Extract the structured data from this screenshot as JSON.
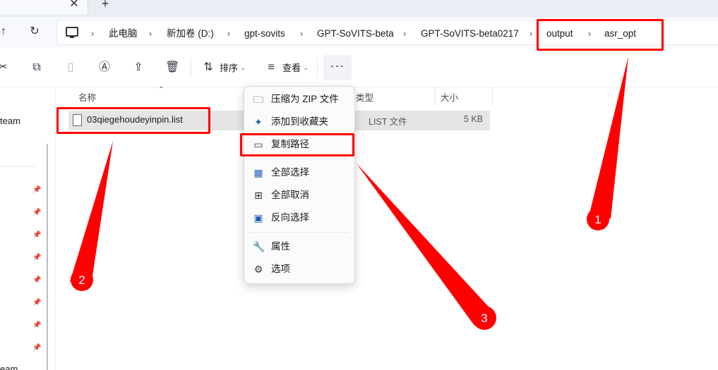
{
  "tab": {
    "close_glyph": "✕",
    "new_glyph": "+"
  },
  "nav": {
    "up_glyph": "↑",
    "refresh_glyph": "↻"
  },
  "breadcrumb": [
    "此电脑",
    "新加卷 (D:)",
    "gpt-sovits",
    "GPT-SoVITS-beta",
    "GPT-SoVITS-beta0217",
    "output",
    "asr_opt"
  ],
  "breadcrumb_separator": "›",
  "toolbar": {
    "sort_label": "排序",
    "view_label": "查看",
    "more_glyph": "···",
    "icons": [
      "cut-icon",
      "copy-icon",
      "paste-icon",
      "rename-icon",
      "share-icon",
      "delete-icon",
      "sort-icon",
      "view-icon"
    ]
  },
  "leftnav": {
    "item_top": "team",
    "item_bottom": "eam",
    "pin_glyph": "📌"
  },
  "columns": {
    "name": "名称",
    "type": "类型",
    "size": "大小"
  },
  "file": {
    "name": "03qiegehoudeyinpin.list",
    "type": "LIST 文件",
    "size": "5 KB"
  },
  "context_menu": [
    {
      "label": "压缩为 ZIP 文件",
      "icon": "zip-icon"
    },
    {
      "label": "添加到收藏夹",
      "icon": "pin-icon"
    },
    {
      "label": "复制路径",
      "icon": "copy-path-icon"
    },
    {
      "label": "全部选择",
      "icon": "select-all-icon"
    },
    {
      "label": "全部取消",
      "icon": "select-none-icon"
    },
    {
      "label": "反向选择",
      "icon": "invert-selection-icon"
    },
    {
      "label": "属性",
      "icon": "properties-icon"
    },
    {
      "label": "选项",
      "icon": "options-icon"
    }
  ],
  "annotations": {
    "badge1": "1",
    "badge2": "2",
    "badge3": "3",
    "color": "#ff0000"
  }
}
